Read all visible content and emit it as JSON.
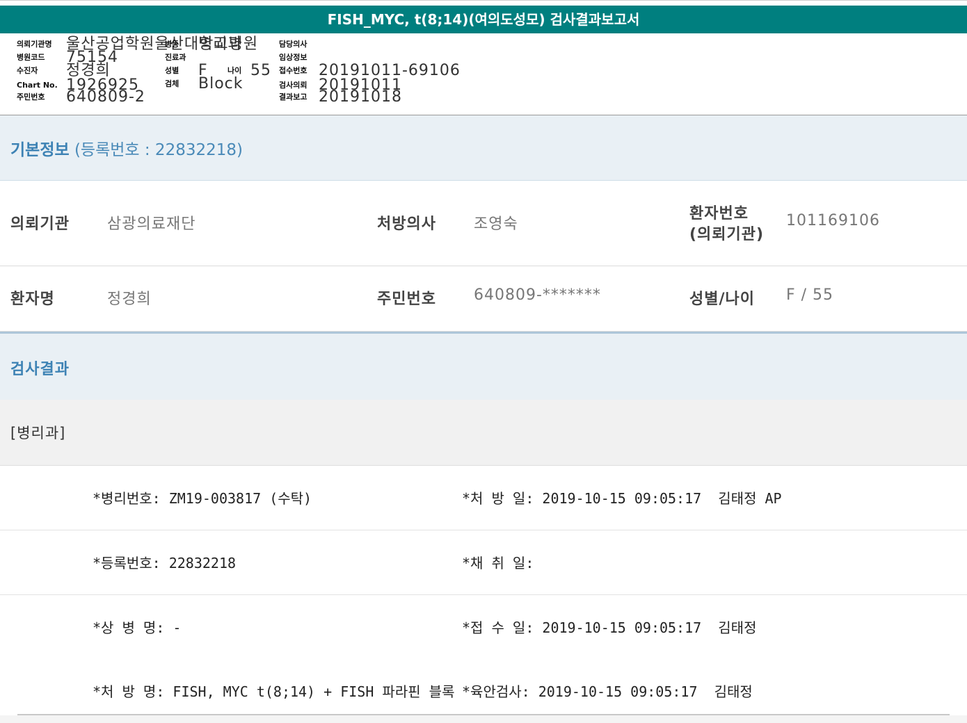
{
  "report": {
    "title": "FISH_MYC, t(8;14)(여의도성모) 검사결과보고서"
  },
  "header": {
    "org_label": "의뢰기관명",
    "org_value": "울산공업학원울산대학교병원",
    "ward_label": "병동",
    "ward_value": "병리과",
    "doctor_label": "담당의사",
    "hosp_code_label": "병원코드",
    "hosp_code_value": "75154",
    "dept_label": "진료과",
    "clinical_label": "임상정보",
    "recipient_label": "수진자",
    "recipient_value": "정경희",
    "sex_label": "성별",
    "sex_value": "F",
    "age_label": "나이",
    "age_value": "55",
    "receipt_label": "접수번호",
    "receipt_value": "20191011-69106",
    "chart_label": "Chart No.",
    "chart_value": "1926925",
    "specimen_label": "검체",
    "specimen_value": "Block",
    "request_label": "검사의뢰",
    "request_value": "20191011",
    "rrn_label": "주민번호",
    "rrn_value": "640809-2",
    "report_label": "결과보고",
    "report_value": "20191018"
  },
  "basic": {
    "title": "기본정보",
    "reg_text": "(등록번호 : 22832218)",
    "rows": [
      {
        "l1": "의뢰기관",
        "v1": "삼광의료재단",
        "l2": "처방의사",
        "v2": "조영숙",
        "l3a": "환자번호",
        "l3b": "(의뢰기관)",
        "v3": "101169106"
      },
      {
        "l1": "환자명",
        "v1": "정경희",
        "l2": "주민번호",
        "v2": "640809-*******",
        "l3": "성별/나이",
        "v3": "F / 55"
      }
    ]
  },
  "results": {
    "title": "검사결과",
    "dept": "[병리과]",
    "rows": [
      {
        "left": "*병리번호: ZM19-003817 (수탁)",
        "right": "*처 방 일: 2019-10-15 09:05:17  김태정 AP"
      },
      {
        "left": "*등록번호: 22832218",
        "right": "*채 취 일:"
      },
      {
        "left": "*상 병 명: -",
        "right": "*접 수 일: 2019-10-15 09:05:17  김태정"
      },
      {
        "left": "*처 방 명: FISH, MYC t(8;14) + FISH 파라핀 블록",
        "right": "*육안검사: 2019-10-15 09:05:17  김태정"
      }
    ]
  },
  "colors": {
    "title_bg": "#007f7f",
    "section_bg": "#e9f0f5",
    "section_title": "#3d82b4"
  }
}
